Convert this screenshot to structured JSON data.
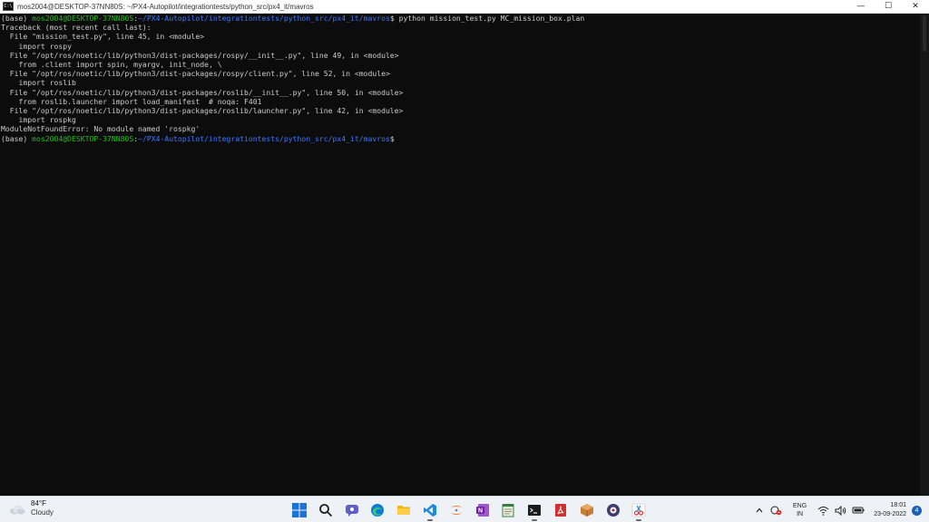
{
  "window": {
    "title": "mos2004@DESKTOP-37NN80S: ~/PX4-Autopilot/integrationtests/python_src/px4_it/mavros",
    "icon_text": "C:\\",
    "minimize": "—",
    "maximize": "☐",
    "close": "✕"
  },
  "terminal": {
    "lines": [
      {
        "segments": [
          {
            "style": "plain",
            "text": "(base) "
          },
          {
            "style": "green",
            "text": "mos2004@DESKTOP-37NN80S"
          },
          {
            "style": "plain",
            "text": ":"
          },
          {
            "style": "blue",
            "text": "~/PX4-Autopilot/integrationtests/python_src/px4_it/mavros"
          },
          {
            "style": "plain",
            "text": "$ python mission_test.py MC_mission_box.plan"
          }
        ]
      },
      {
        "segments": [
          {
            "style": "plain",
            "text": "Traceback (most recent call last):"
          }
        ]
      },
      {
        "segments": [
          {
            "style": "plain",
            "text": "  File \"mission_test.py\", line 45, in <module>"
          }
        ]
      },
      {
        "segments": [
          {
            "style": "plain",
            "text": "    import rospy"
          }
        ]
      },
      {
        "segments": [
          {
            "style": "plain",
            "text": "  File \"/opt/ros/noetic/lib/python3/dist-packages/rospy/__init__.py\", line 49, in <module>"
          }
        ]
      },
      {
        "segments": [
          {
            "style": "plain",
            "text": "    from .client import spin, myargv, init_node, \\"
          }
        ]
      },
      {
        "segments": [
          {
            "style": "plain",
            "text": "  File \"/opt/ros/noetic/lib/python3/dist-packages/rospy/client.py\", line 52, in <module>"
          }
        ]
      },
      {
        "segments": [
          {
            "style": "plain",
            "text": "    import roslib"
          }
        ]
      },
      {
        "segments": [
          {
            "style": "plain",
            "text": "  File \"/opt/ros/noetic/lib/python3/dist-packages/roslib/__init__.py\", line 50, in <module>"
          }
        ]
      },
      {
        "segments": [
          {
            "style": "plain",
            "text": "    from roslib.launcher import load_manifest  # noqa: F401"
          }
        ]
      },
      {
        "segments": [
          {
            "style": "plain",
            "text": "  File \"/opt/ros/noetic/lib/python3/dist-packages/roslib/launcher.py\", line 42, in <module>"
          }
        ]
      },
      {
        "segments": [
          {
            "style": "plain",
            "text": "    import rospkg"
          }
        ]
      },
      {
        "segments": [
          {
            "style": "plain",
            "text": "ModuleNotFoundError: No module named 'rospkg'"
          }
        ]
      },
      {
        "segments": [
          {
            "style": "plain",
            "text": "(base) "
          },
          {
            "style": "green",
            "text": "mos2004@DESKTOP-37NN80S"
          },
          {
            "style": "plain",
            "text": ":"
          },
          {
            "style": "blue",
            "text": "~/PX4-Autopilot/integrationtests/python_src/px4_it/mavros"
          },
          {
            "style": "plain",
            "text": "$"
          }
        ]
      }
    ]
  },
  "taskbar": {
    "weather": {
      "temp": "84°F",
      "condition": "Cloudy",
      "icon": "cloud-icon"
    },
    "apps": [
      {
        "name": "start",
        "icon": "windows-start-icon"
      },
      {
        "name": "search",
        "icon": "search-icon"
      },
      {
        "name": "chat",
        "icon": "chat-icon"
      },
      {
        "name": "edge",
        "icon": "edge-browser-icon"
      },
      {
        "name": "file-explorer",
        "icon": "folder-icon"
      },
      {
        "name": "vscode",
        "icon": "vscode-icon"
      },
      {
        "name": "jupyter",
        "icon": "jupyter-icon"
      },
      {
        "name": "onenote",
        "icon": "onenote-icon"
      },
      {
        "name": "notepad",
        "icon": "notepad-icon"
      },
      {
        "name": "terminal",
        "icon": "terminal-icon"
      },
      {
        "name": "acrobat",
        "icon": "pdf-icon"
      },
      {
        "name": "package",
        "icon": "package-icon"
      },
      {
        "name": "media",
        "icon": "media-player-icon"
      },
      {
        "name": "snipping",
        "icon": "snipping-tool-icon"
      }
    ],
    "tray": {
      "language_line1": "ENG",
      "language_line2": "IN",
      "time": "18:01",
      "date": "23-09-2022",
      "notifications": "4"
    }
  }
}
